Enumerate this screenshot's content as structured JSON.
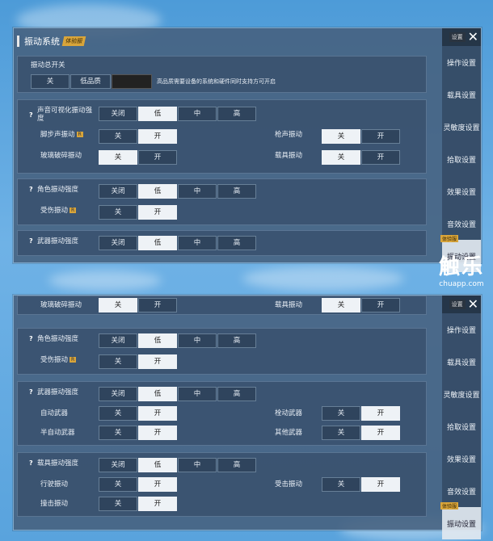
{
  "top": {
    "title": "振动系统",
    "title_badge": "体验服",
    "side": {
      "header_label": "设置",
      "close": "✕",
      "items": [
        "操作设置",
        "载具设置",
        "灵敏度设置",
        "拾取设置",
        "效果设置",
        "音效设置",
        "振动设置"
      ],
      "active_badge": "体验服"
    },
    "master": {
      "label": "振动总开关",
      "opt_off": "关",
      "opt_low": "低品质",
      "note": "高品质需要设备的系统和硬件同时支持方可开启"
    },
    "sound": {
      "label": "声音可视化振动强度",
      "levels": [
        "关闭",
        "低",
        "中",
        "高"
      ],
      "footstep": "脚步声振动",
      "footstep_badge": "R",
      "gunshot": "枪声振动",
      "glass": "玻璃破碎振动",
      "vehicle": "载具振动",
      "off": "关",
      "on": "开"
    },
    "char": {
      "label": "角色振动强度",
      "levels": [
        "关闭",
        "低",
        "中",
        "高"
      ],
      "hurt": "受伤振动",
      "hurt_badge": "R",
      "off": "关",
      "on": "开"
    },
    "weapon": {
      "label": "武器振动强度",
      "levels": [
        "关闭",
        "低",
        "中",
        "高"
      ]
    }
  },
  "bottom": {
    "side": {
      "header_label": "设置",
      "close": "✕",
      "items": [
        "操作设置",
        "载具设置",
        "灵敏度设置",
        "拾取设置",
        "效果设置",
        "音效设置",
        "振动设置"
      ],
      "active_badge": "体验服"
    },
    "partial": {
      "glass": "玻璃破碎振动",
      "vehicle": "载具振动",
      "off": "关",
      "on": "开"
    },
    "char": {
      "label": "角色振动强度",
      "levels": [
        "关闭",
        "低",
        "中",
        "高"
      ],
      "hurt": "受伤振动",
      "hurt_badge": "R",
      "off": "关",
      "on": "开"
    },
    "weapon": {
      "label": "武器振动强度",
      "levels": [
        "关闭",
        "低",
        "中",
        "高"
      ],
      "auto": "自动武器",
      "bolt": "栓动武器",
      "semi": "半自动武器",
      "other": "其他武器",
      "off": "关",
      "on": "开"
    },
    "vehicle": {
      "label": "载具振动强度",
      "levels": [
        "关闭",
        "低",
        "中",
        "高"
      ],
      "driving": "行驶振动",
      "hit": "受击振动",
      "crash": "撞击振动",
      "off": "关",
      "on": "开"
    }
  },
  "watermark": {
    "brand": "触乐",
    "url": "chuapp.com"
  },
  "colors": {
    "accent_badge": "#d9a53a",
    "selected_option": "#eef2f6",
    "panel": "#46607d"
  }
}
